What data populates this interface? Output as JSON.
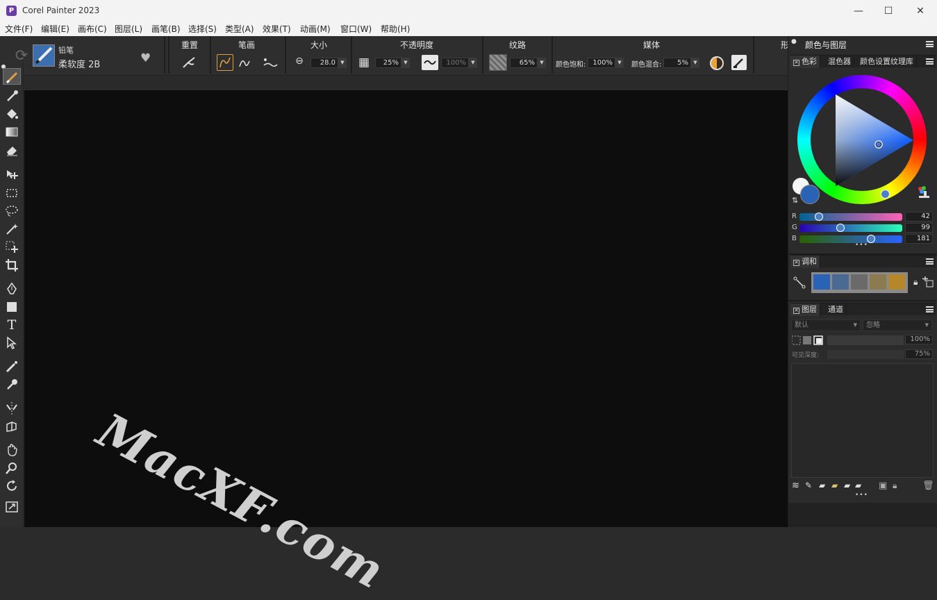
{
  "window": {
    "title": "Corel Painter 2023",
    "app_icon": "P",
    "minimize": "—",
    "maximize": "☐",
    "close": "✕"
  },
  "menu": [
    "文件(F)",
    "编辑(E)",
    "画布(C)",
    "图层(L)",
    "画笔(B)",
    "选择(S)",
    "类型(A)",
    "效果(T)",
    "动画(M)",
    "窗口(W)",
    "帮助(H)"
  ],
  "brush": {
    "category": "铅笔",
    "variant": "柔软度 2B"
  },
  "property_bar": {
    "reset_label": "重置",
    "stroke_label": "笔画",
    "size_label": "大小",
    "size_value": "28.0",
    "opacity_label": "不透明度",
    "opacity_value": "25%",
    "opacity2_value": "100%",
    "grain_label": "纹路",
    "grain_value": "65%",
    "media_label": "媒体",
    "saturation_label": "颜色饱和:",
    "saturation_value": "100%",
    "blend_label": "颜色混合:",
    "blend_value": "5%",
    "overflow_label": "形"
  },
  "color_panel": {
    "title": "颜色与图层",
    "tabs": [
      "色彩",
      "混色器",
      "颜色设置纹理库"
    ],
    "r_label": "R",
    "g_label": "G",
    "b_label": "B",
    "r_value": "42",
    "g_value": "99",
    "b_value": "181",
    "r": 42,
    "g": 99,
    "b": 181,
    "main_color": "#2a63b5",
    "more": "•••"
  },
  "harmony_panel": {
    "tab": "调和",
    "swatches": [
      "#2a63b5",
      "#4a6a94",
      "#6a6a6a",
      "#8c7a50",
      "#b5862a"
    ]
  },
  "layers_panel": {
    "tabs": [
      "图层",
      "通道"
    ],
    "composite_method": "默认",
    "ignore_select": "忽略",
    "opacity_value": "100%",
    "depth_label": "可见深度:",
    "depth_value": "75%",
    "more": "•••"
  },
  "canvas": {
    "watermark": "MacXF.com",
    "background": "#0d0d0d"
  }
}
